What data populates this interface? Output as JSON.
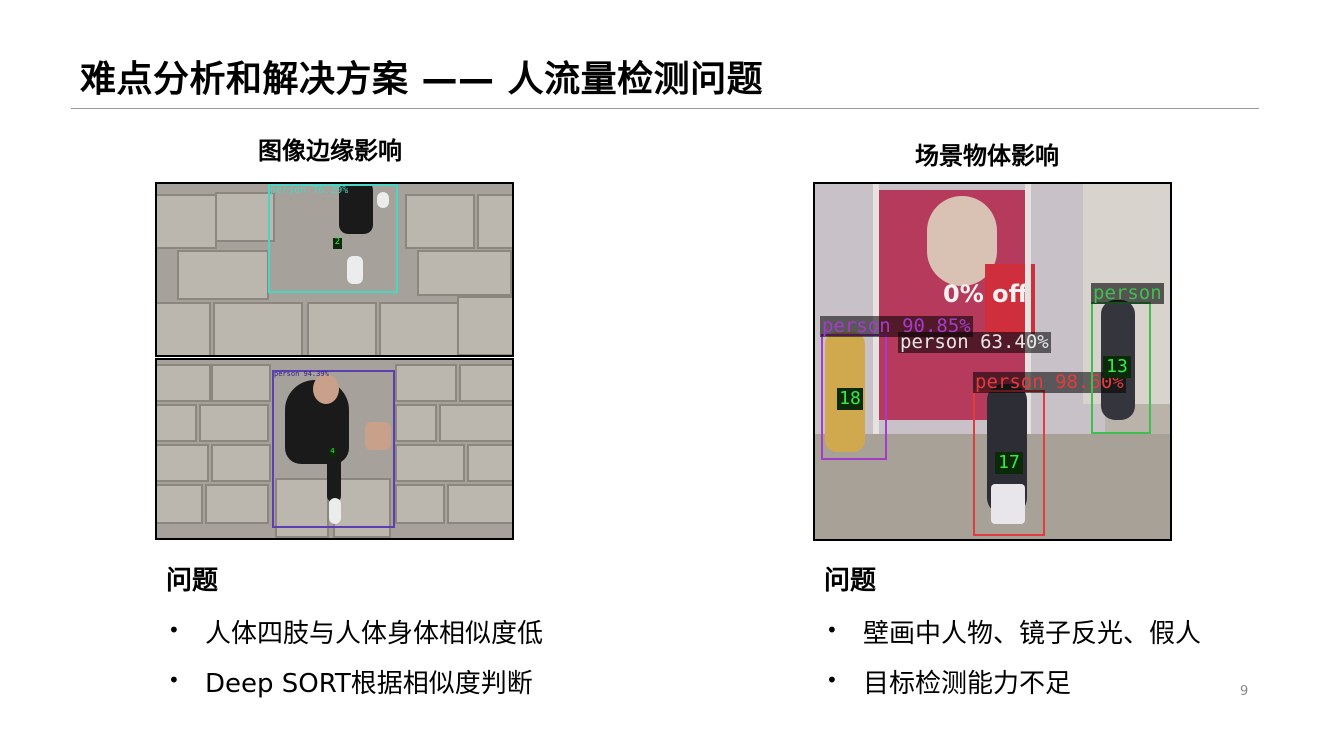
{
  "slide": {
    "title": "难点分析和解决方案 —— 人流量检测问题",
    "page_number": "9"
  },
  "left": {
    "caption": "图像边缘影响",
    "top_image": {
      "label": "person 76.29%",
      "id": "2",
      "box_color": "#49d6c2"
    },
    "bottom_image": {
      "label": "person 94.39%",
      "id": "4",
      "box_color": "#5b3fb3"
    },
    "problem_heading": "问题",
    "bullets": [
      "人体四肢与人体身体相似度低",
      "Deep SORT根据相似度判断"
    ]
  },
  "right": {
    "caption": "场景物体影响",
    "store_sign": "0% off",
    "detections": [
      {
        "label": "person 90.85%",
        "id": "18",
        "color": "#a43cc9"
      },
      {
        "label": "person 63.40%",
        "id": "",
        "color": "#e6e6e6"
      },
      {
        "label": "person 98.60%",
        "id": "17",
        "color": "#e23c3c"
      },
      {
        "label": "person",
        "id": "13",
        "color": "#3fbf4f"
      }
    ],
    "problem_heading": "问题",
    "bullets": [
      "壁画中人物、镜子反光、假人",
      "目标检测能力不足"
    ]
  },
  "bullet_symbol": "•"
}
